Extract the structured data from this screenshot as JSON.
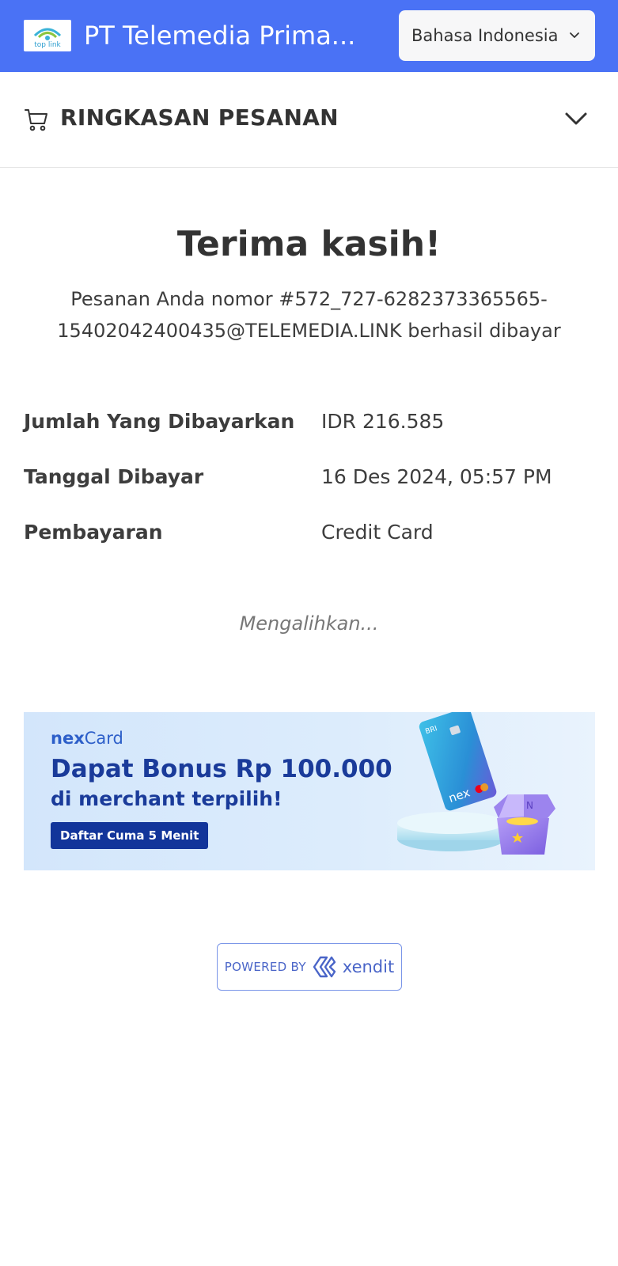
{
  "header": {
    "logo_text": "top link",
    "merchant_name": "PT Telemedia Prima...",
    "language": "Bahasa Indonesia",
    "colors": {
      "background": "#4a72f5",
      "select_bg": "#f7f7f8"
    }
  },
  "summary": {
    "icon": "cart-icon",
    "title": "RINGKASAN PESANAN",
    "toggle_icon": "chevron-down-icon"
  },
  "confirmation": {
    "title": "Terima kasih!",
    "message_line1": "Pesanan Anda nomor #572_727-6282373365565-",
    "message_line2": "15402042400435@TELEMEDIA.LINK berhasil dibayar"
  },
  "details": [
    {
      "label": "Jumlah Yang Dibayarkan",
      "value": "IDR 216.585"
    },
    {
      "label": "Tanggal Dibayar",
      "value": "16 Des 2024, 05:57 PM"
    },
    {
      "label": "Pembayaran",
      "value": "Credit Card"
    }
  ],
  "redirect_text": "Mengalihkan...",
  "banner": {
    "brand_prefix": "nex",
    "brand_suffix": "Card",
    "headline": "Dapat Bonus Rp 100.000",
    "subline": "di merchant terpilih!",
    "cta": "Daftar Cuma 5 Menit",
    "card_bank": "BRI",
    "card_brand": "nex",
    "colors": {
      "headline": "#1a3b9a",
      "cta_bg": "#12359a"
    }
  },
  "footer": {
    "powered_label": "POWERED BY",
    "provider": "xendit",
    "provider_icon": "xendit-logo-icon"
  }
}
